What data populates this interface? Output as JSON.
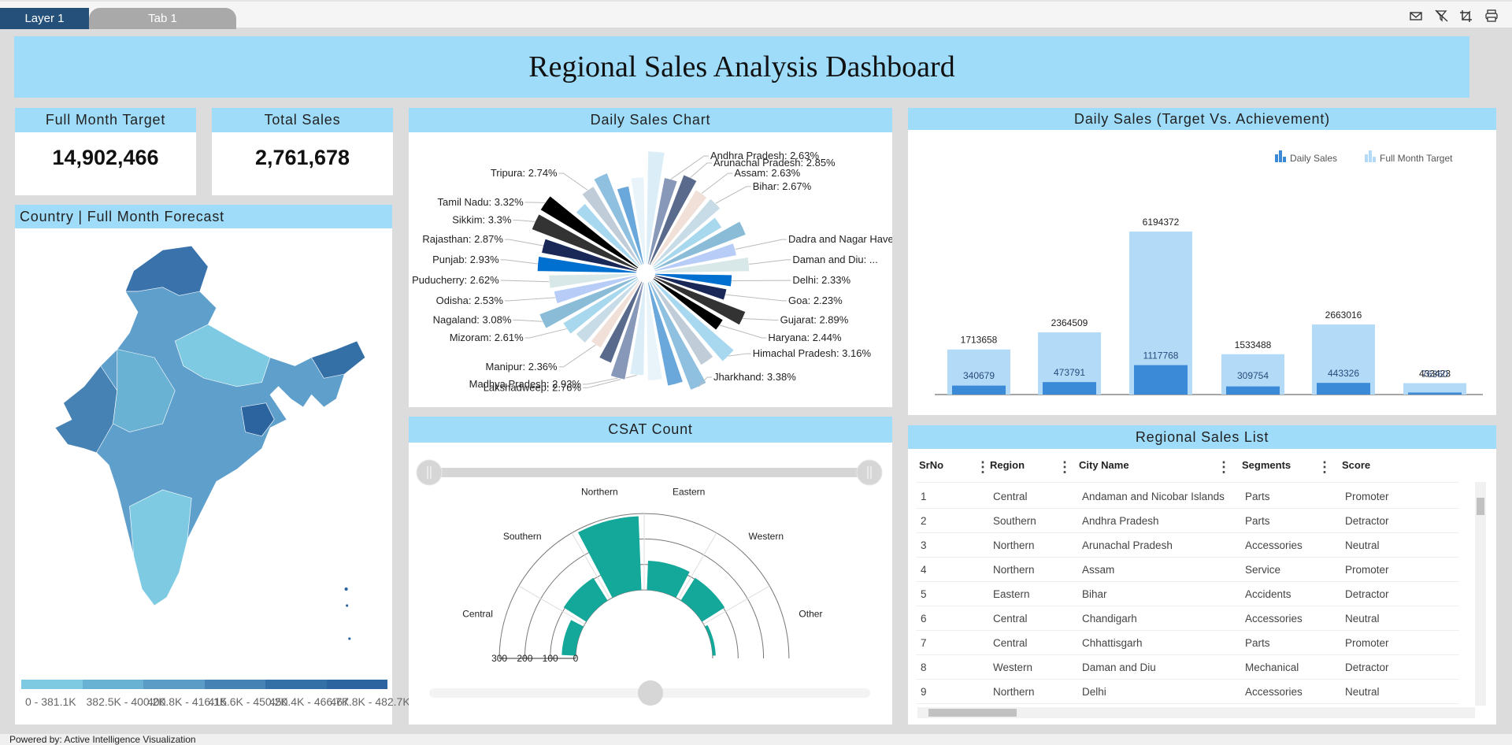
{
  "tabs": {
    "layer": "Layer 1",
    "tab": "Tab 1"
  },
  "toolbar_icons": [
    "mail-icon",
    "clear-filter-icon",
    "crop-icon",
    "print-icon"
  ],
  "title": "Regional Sales Analysis Dashboard",
  "kpis": {
    "target_label": "Full Month Target",
    "target_value": "14,902,466",
    "sales_label": "Total Sales",
    "sales_value": "2,761,678"
  },
  "map": {
    "title": "Country | Full Month Forecast",
    "legend_colors": [
      "#7fcae3",
      "#6ab2d3",
      "#5a9cc6",
      "#4682b4",
      "#3470a5",
      "#2c64a0"
    ],
    "legend_labels": [
      "0 - 381.1K",
      "382.5K - 400.2K",
      "400.8K - 416.1K",
      "415.6K - 450.2K",
      "450.4K - 466.7K",
      "467.8K - 482.7K"
    ]
  },
  "polar": {
    "title": "Daily Sales Chart",
    "palette": [
      "#dbeef8",
      "#8898b8",
      "#5a6a8c",
      "#f0e0d8",
      "#c8dce8",
      "#a8d8ee",
      "#8abcd8",
      "#b8ccf8",
      "#d8e8e8",
      "#0070d0",
      "#1a2858",
      "#333333",
      "#000000",
      "#a8d8f0",
      "#c0ccd8",
      "#90c0e0",
      "#6aa8dc",
      "#e8f4fa"
    ],
    "chart_data": {
      "type": "pie",
      "slices": [
        {
          "label": "",
          "value": 3.3
        },
        {
          "label": "Andhra Pradesh: 2.63%",
          "value": 2.63
        },
        {
          "label": "Arunachal Pradesh: 2.85%",
          "value": 2.85
        },
        {
          "label": "Assam: 2.63%",
          "value": 2.63
        },
        {
          "label": "Bihar: 2.67%",
          "value": 2.67
        },
        {
          "label": "",
          "value": 2.4
        },
        {
          "label": "",
          "value": 2.9
        },
        {
          "label": "Dadra and Nagar Haveli...",
          "value": 2.5
        },
        {
          "label": "Daman and Diu: ...",
          "value": 2.8
        },
        {
          "label": "Delhi: 2.33%",
          "value": 2.33
        },
        {
          "label": "Goa: 2.23%",
          "value": 2.23
        },
        {
          "label": "Gujarat: 2.89%",
          "value": 2.89
        },
        {
          "label": "Haryana: 2.44%",
          "value": 2.44
        },
        {
          "label": "Himachal Pradesh: 3.16%",
          "value": 3.16
        },
        {
          "label": "",
          "value": 2.9
        },
        {
          "label": "Jharkhand: 3.38%",
          "value": 3.38
        },
        {
          "label": "",
          "value": 3.1
        },
        {
          "label": "",
          "value": 2.9
        },
        {
          "label": "Lakshadweep: 2.76%",
          "value": 2.76
        },
        {
          "label": "Madhya Pradesh: 2.93%",
          "value": 2.93
        },
        {
          "label": "",
          "value": 2.6
        },
        {
          "label": "Manipur: 2.36%",
          "value": 2.36
        },
        {
          "label": "",
          "value": 2.5
        },
        {
          "label": "Mizoram: 2.61%",
          "value": 2.61
        },
        {
          "label": "Nagaland: 3.08%",
          "value": 3.08
        },
        {
          "label": "Odisha: 2.53%",
          "value": 2.53
        },
        {
          "label": "Puducherry: 2.62%",
          "value": 2.62
        },
        {
          "label": "Punjab: 2.93%",
          "value": 2.93
        },
        {
          "label": "Rajasthan: 2.87%",
          "value": 2.87
        },
        {
          "label": "Sikkim: 3.3%",
          "value": 3.3
        },
        {
          "label": "Tamil Nadu: 3.32%",
          "value": 3.32
        },
        {
          "label": "",
          "value": 2.5
        },
        {
          "label": "Tripura: 2.74%",
          "value": 2.74
        },
        {
          "label": "",
          "value": 2.9
        },
        {
          "label": "",
          "value": 2.4
        },
        {
          "label": "",
          "value": 2.6
        }
      ]
    }
  },
  "csat": {
    "title": "CSAT Count",
    "color": "#14a89a",
    "chart_data": {
      "type": "bar",
      "polar": true,
      "categories": [
        "Central",
        "Southern",
        "Northern",
        "Eastern",
        "Western",
        "Other"
      ],
      "values": [
        55,
        105,
        290,
        115,
        105,
        12
      ],
      "axis_ticks": [
        "300",
        "200",
        "100",
        "0"
      ],
      "ylim": [
        0,
        300
      ]
    }
  },
  "bars": {
    "title": "Daily Sales (Target Vs. Achievement)",
    "chart_data": {
      "type": "bar",
      "series": [
        {
          "name": "Daily Sales",
          "color": "#3a8ad8",
          "values": [
            340679,
            473791,
            1117768,
            309754,
            443326,
            76360
          ]
        },
        {
          "name": "Full Month Target",
          "color": "#b3dbf8",
          "values": [
            1713658,
            2364509,
            6194372,
            1533488,
            2663016,
            433423
          ]
        }
      ]
    }
  },
  "table": {
    "title": "Regional Sales List",
    "columns": [
      "SrNo",
      "Region",
      "City Name",
      "Segments",
      "Score"
    ],
    "rows": [
      [
        "1",
        "Central",
        "Andaman and Nicobar Islands",
        "Parts",
        "Promoter"
      ],
      [
        "2",
        "Southern",
        "Andhra Pradesh",
        "Parts",
        "Detractor"
      ],
      [
        "3",
        "Northern",
        "Arunachal Pradesh",
        "Accessories",
        "Neutral"
      ],
      [
        "4",
        "Northern",
        "Assam",
        "Service",
        "Promoter"
      ],
      [
        "5",
        "Eastern",
        "Bihar",
        "Accidents",
        "Detractor"
      ],
      [
        "6",
        "Central",
        "Chandigarh",
        "Accessories",
        "Neutral"
      ],
      [
        "7",
        "Central",
        "Chhattisgarh",
        "Parts",
        "Promoter"
      ],
      [
        "8",
        "Western",
        "Daman and Diu",
        "Mechanical",
        "Detractor"
      ],
      [
        "9",
        "Northern",
        "Delhi",
        "Accessories",
        "Neutral"
      ]
    ]
  },
  "footer": "Powered by: Active Intelligence Visualization"
}
